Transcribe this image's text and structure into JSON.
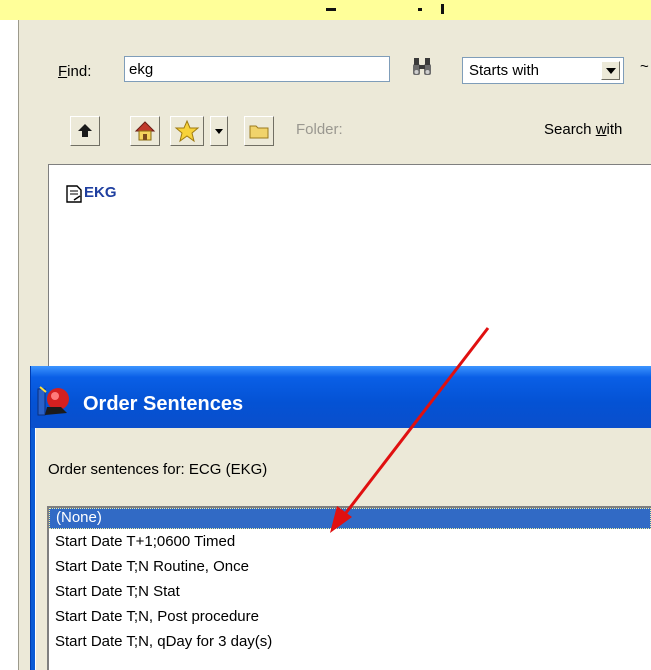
{
  "find": {
    "label_prefix": "F",
    "label_rest": "ind:",
    "value": "ekg",
    "match_mode": "Starts with"
  },
  "toolbar": {
    "folder_label": "Folder:",
    "search_within_prefix": "Search ",
    "search_within_underlined": "w",
    "search_within_rest": "ith"
  },
  "results": {
    "items": [
      {
        "label": "EKG",
        "icon": "document-icon"
      }
    ]
  },
  "dialog": {
    "title": "Order Sentences",
    "sentences_label": "Order sentences for:  ECG (EKG)",
    "sentences": [
      "(None)",
      "Start Date T+1;0600 Timed",
      "Start Date T;N Routine, Once",
      "Start Date T;N Stat",
      "Start Date T;N, Post procedure",
      "Start Date T;N, qDay for 3 day(s)"
    ],
    "selected_index": 0
  },
  "colors": {
    "titlebar": "#0a5bd6",
    "selection": "#316ac5",
    "annotation_arrow": "#e01010",
    "panel": "#ece9d8"
  }
}
